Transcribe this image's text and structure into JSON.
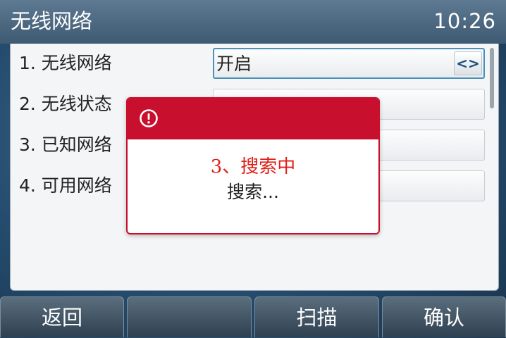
{
  "header": {
    "title": "无线网络",
    "time": "10:26"
  },
  "menu": {
    "items": [
      {
        "label": "1. 无线网络",
        "value": "开启",
        "selected": true
      },
      {
        "label": "2. 无线状态",
        "value": ""
      },
      {
        "label": "3. 已知网络",
        "value": ""
      },
      {
        "label": "4. 可用网络",
        "value": ""
      }
    ],
    "switch_glyph": "<>"
  },
  "dialog": {
    "icon": "alert-circle-icon",
    "step": "3、搜索中",
    "message": "搜索..."
  },
  "softkeys": {
    "back": "返回",
    "empty": "",
    "scan": "扫描",
    "ok": "确认"
  },
  "colors": {
    "accent_red": "#c8102e",
    "step_text_red": "#e0201a",
    "header_bg": "#4d6a82",
    "selection_border": "#4a90b8"
  }
}
